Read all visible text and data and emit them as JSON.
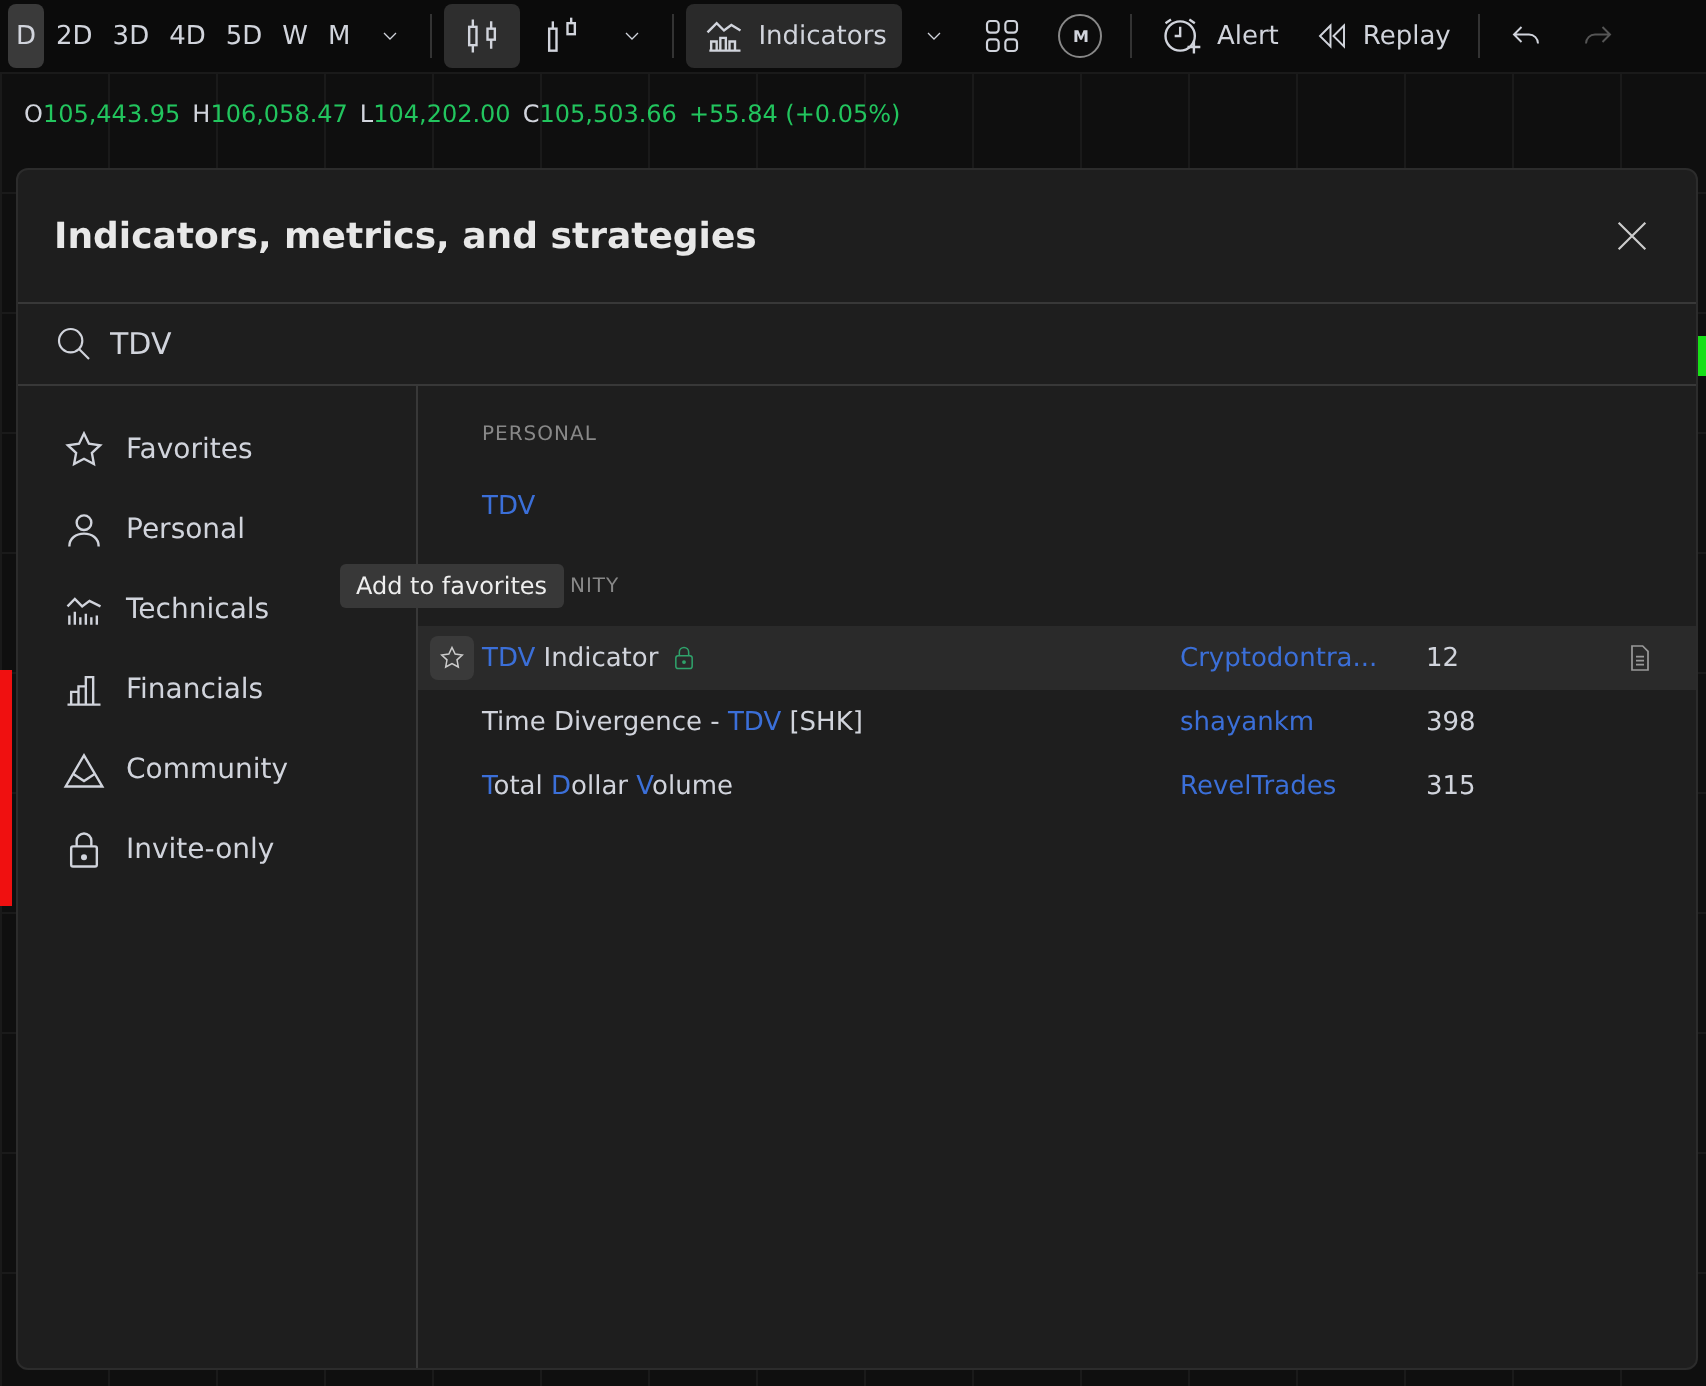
{
  "toolbar": {
    "intervals": [
      {
        "label": "D",
        "selected": true
      },
      {
        "label": "2D",
        "selected": false
      },
      {
        "label": "3D",
        "selected": false
      },
      {
        "label": "4D",
        "selected": false
      },
      {
        "label": "5D",
        "selected": false
      },
      {
        "label": "W",
        "selected": false
      },
      {
        "label": "M",
        "selected": false
      }
    ],
    "indicators": {
      "label": "Indicators",
      "active": true
    },
    "badge": "M",
    "alert": "Alert",
    "replay": "Replay",
    "redo": {
      "disabled": true
    }
  },
  "ohlc": [
    {
      "key": "O",
      "value": "105,443.95"
    },
    {
      "key": "H",
      "value": "106,058.47"
    },
    {
      "key": "L",
      "value": "104,202.00"
    },
    {
      "key": "C",
      "value": "105,503.66"
    }
  ],
  "change": "+55.84 (+0.05%)",
  "dialog": {
    "title": "Indicators, metrics, and strategies",
    "search": {
      "value": "TDV"
    },
    "categories": [
      {
        "label": "Favorites",
        "kind": "star"
      },
      {
        "label": "Personal",
        "kind": "person"
      },
      {
        "label": "Technicals",
        "kind": "technicals"
      },
      {
        "label": "Financials",
        "kind": "financials"
      },
      {
        "label": "Community",
        "kind": "community"
      },
      {
        "label": "Invite-only",
        "kind": "lock"
      }
    ],
    "sections": [
      {
        "heading": "PERSONAL",
        "items": [
          {
            "name": [
              {
                "text": "TDV",
                "match": true
              }
            ],
            "hovered": false,
            "locked": false
          }
        ]
      },
      {
        "heading": "NITY",
        "items": [
          {
            "name": [
              {
                "text": "TDV",
                "match": true
              },
              {
                "text": " Indicator",
                "match": false
              }
            ],
            "author": "Cryptodontra...",
            "count": "12",
            "hovered": true,
            "locked": true
          },
          {
            "name": [
              {
                "text": "Time Divergence - ",
                "match": false
              },
              {
                "text": "TDV",
                "match": true
              },
              {
                "text": " [SHK]",
                "match": false
              }
            ],
            "author": "shayankm",
            "count": "398",
            "hovered": false,
            "locked": false
          },
          {
            "name": [
              {
                "text": "T",
                "match": true
              },
              {
                "text": "otal ",
                "match": false
              },
              {
                "text": "D",
                "match": true
              },
              {
                "text": "ollar ",
                "match": false
              },
              {
                "text": "V",
                "match": true
              },
              {
                "text": "olume",
                "match": false
              }
            ],
            "author": "RevelTrades",
            "count": "315",
            "hovered": false,
            "locked": false
          }
        ]
      }
    ],
    "tooltip": "Add to favorites"
  }
}
